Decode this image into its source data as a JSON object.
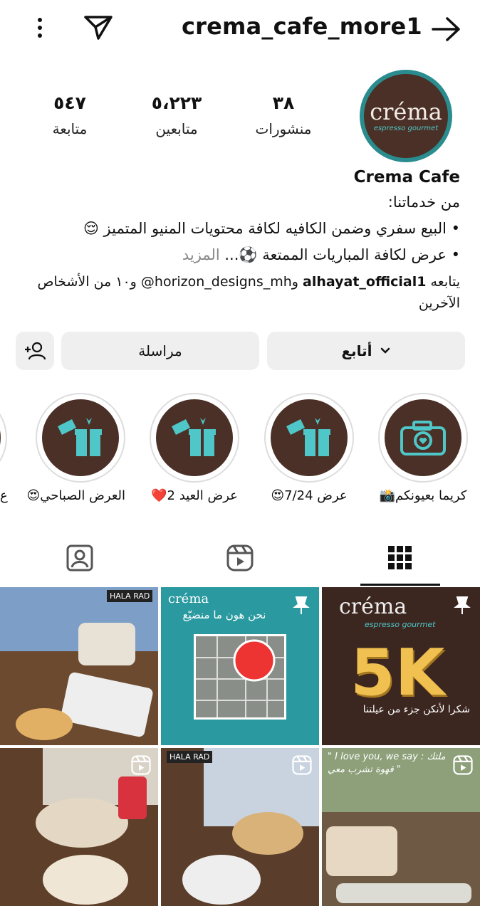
{
  "header": {
    "username": "crema_cafe_more1"
  },
  "profile": {
    "avatar_brand": "créma",
    "avatar_sub": "espresso gourmet",
    "stats": [
      {
        "value": "٣٨",
        "label": "منشورات"
      },
      {
        "value": "٥،٢٢٣",
        "label": "متابعين"
      },
      {
        "value": "٥٤٧",
        "label": "متابعة"
      }
    ],
    "name": "Crema Cafe",
    "bio": {
      "line1": "من خدماتنا:",
      "line2": "• البيع سفري وضمن الكافيه لكافة محتويات المنيو المتميز 😌",
      "line3": "• عرض لكافة المباريات الممتعة ⚽...",
      "more": "المزيد",
      "followed_prefix": "يتابعه",
      "followed_user1": "alhayat_official1",
      "followed_mid": "و",
      "followed_user2": "horizon_designs_mh@",
      "followed_suffix": "و١٠ من الأشخاص الآخرين"
    }
  },
  "actions": {
    "follow": "أتابع",
    "message": "مراسلة"
  },
  "highlights": [
    {
      "label": "كريما بعيونكم📸",
      "icon": "camera-icon"
    },
    {
      "label": "عرض 7/24😍",
      "icon": "gift-icon"
    },
    {
      "label": "عرض العيد 2❤️",
      "icon": "gift-icon"
    },
    {
      "label": "العرض الصباحي😍",
      "icon": "gift-icon"
    },
    {
      "label": "ع",
      "icon": "gift-icon"
    }
  ],
  "tabs": [
    {
      "name": "grid",
      "icon": "grid-icon",
      "active": true
    },
    {
      "name": "reels",
      "icon": "reels-icon",
      "active": false
    },
    {
      "name": "tagged",
      "icon": "tagged-icon",
      "active": false
    }
  ],
  "posts": [
    {
      "id": "post-1",
      "text": "créma",
      "sub": "espresso gourmet",
      "big": "5K",
      "caption": "شكرا لأنكن جزء من عيلتنا",
      "badge": "pin-icon"
    },
    {
      "id": "post-2",
      "text": "نحن هون ما منضيّع",
      "badge": "pin-icon"
    },
    {
      "id": "post-3",
      "text": "HALA RAD",
      "badge": "multi-icon"
    },
    {
      "id": "post-4",
      "text": "\" I love you, we say : ملتك قهوة تشرب معي \"",
      "badge": "reel-icon"
    },
    {
      "id": "post-5",
      "text": "HALA RAD",
      "badge": "reel-icon"
    },
    {
      "id": "post-6",
      "text": "",
      "badge": "reel-icon"
    }
  ]
}
